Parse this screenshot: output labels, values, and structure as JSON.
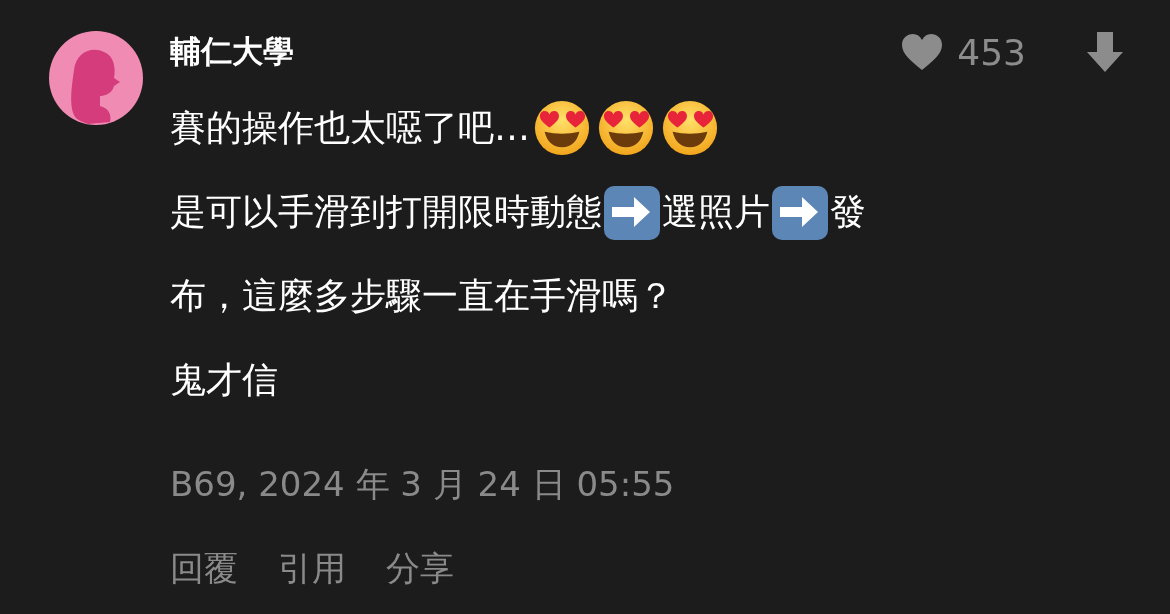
{
  "comment": {
    "author": "輔仁大學",
    "likes": "453",
    "lines": [
      [
        {
          "kind": "text",
          "text": "賽的操作也太噁了吧…"
        },
        {
          "kind": "heart-eyes-emoji"
        },
        {
          "kind": "heart-eyes-emoji"
        },
        {
          "kind": "heart-eyes-emoji"
        }
      ],
      [
        {
          "kind": "text",
          "text": "是可以手滑到打開限時動態"
        },
        {
          "kind": "arrow-emoji"
        },
        {
          "kind": "text",
          "text": "選照片"
        },
        {
          "kind": "arrow-emoji"
        },
        {
          "kind": "text",
          "text": "發"
        }
      ],
      [
        {
          "kind": "text",
          "text": "布，這麼多步驟一直在手滑嗎？"
        }
      ],
      [
        {
          "kind": "text",
          "text": "鬼才信"
        }
      ]
    ],
    "meta": "B69, 2024 年 3 月 24 日 05:55",
    "actions": [
      "回覆",
      "引用",
      "分享"
    ]
  }
}
